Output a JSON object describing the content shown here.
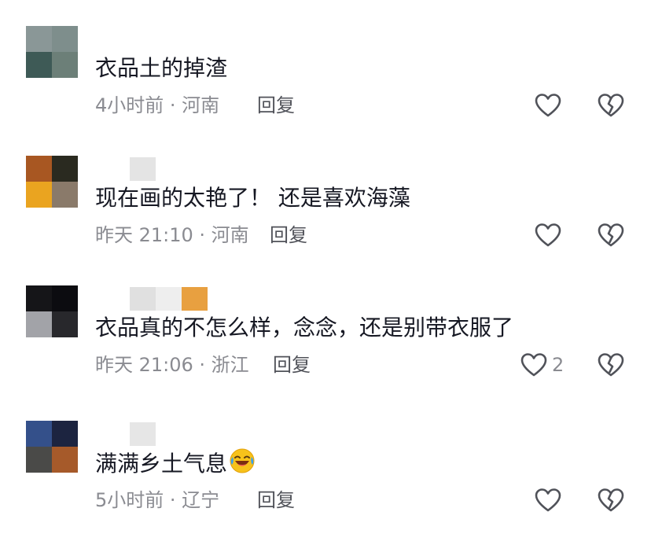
{
  "comments": [
    {
      "avatar_colors": [
        "#8a9797",
        "#7e8e8c",
        "#3e5a56",
        "#6c7f78"
      ],
      "name_colors": [],
      "text": "衣品土的掉渣",
      "meta": "4小时前 · 河南",
      "reply": "回复",
      "likes": ""
    },
    {
      "avatar_colors": [
        "#a85722",
        "#2a2a20",
        "#eaa420",
        "#8a7a6a"
      ],
      "name_colors": [
        "#e4e4e4"
      ],
      "text": "现在画的太艳了！ 还是喜欢海藻",
      "meta": "昨天 21:10 · 河南",
      "reply": "回复",
      "likes": ""
    },
    {
      "avatar_colors": [
        "#151518",
        "#0c0c10",
        "#a2a3a8",
        "#28282c"
      ],
      "name_colors": [
        "#e0e0e0",
        "#eeeeee",
        "#e8a040"
      ],
      "text": "衣品真的不怎么样，念念，还是别带衣服了",
      "meta": "昨天 21:06 · 浙江",
      "reply": "回复",
      "likes": "2"
    },
    {
      "avatar_colors": [
        "#34508a",
        "#1c2440",
        "#4a4a48",
        "#a65a2a"
      ],
      "name_colors": [
        "#e6e6e6"
      ],
      "text": "满满乡土气息",
      "meta": "5小时前 · 辽宁",
      "reply": "回复",
      "likes": ""
    }
  ],
  "icons": {
    "like": "heart-outline-icon",
    "dislike": "broken-heart-icon",
    "emoji": "laughing-tears-emoji"
  },
  "colors": {
    "text": "#161823",
    "meta": "#8a8b91",
    "reply": "#505259",
    "icon": "#505259"
  }
}
